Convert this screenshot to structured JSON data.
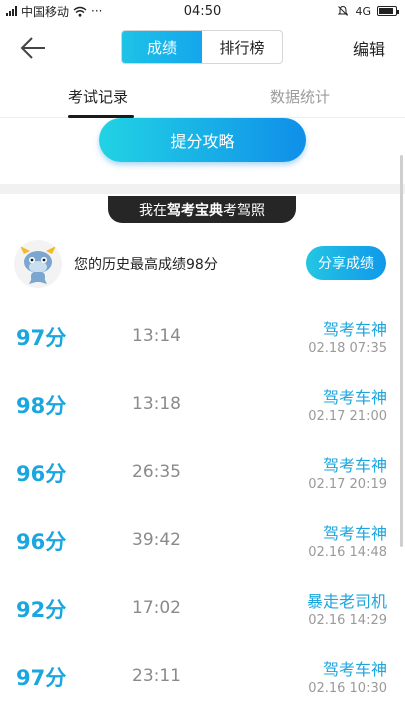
{
  "status_bar": {
    "carrier": "中国移动",
    "more": "···",
    "time": "04:50",
    "network": "4G"
  },
  "nav": {
    "segments": [
      "成绩",
      "排行榜"
    ],
    "active_segment": 0,
    "edit_label": "编辑"
  },
  "tabs": [
    {
      "label": "考试记录",
      "active": true
    },
    {
      "label": "数据统计",
      "active": false
    }
  ],
  "tip_button": "提分攻略",
  "banner": {
    "prefix": "我在",
    "brand": "驾考宝典",
    "suffix": "考驾照"
  },
  "best": {
    "text": "您的历史最高成绩98分",
    "share_label": "分享成绩"
  },
  "records": [
    {
      "score": "97分",
      "duration": "13:14",
      "title": "驾考车神",
      "date": "02.18  07:35"
    },
    {
      "score": "98分",
      "duration": "13:18",
      "title": "驾考车神",
      "date": "02.17  21:00"
    },
    {
      "score": "96分",
      "duration": "26:35",
      "title": "驾考车神",
      "date": "02.17  20:19"
    },
    {
      "score": "96分",
      "duration": "39:42",
      "title": "驾考车神",
      "date": "02.16  14:48"
    },
    {
      "score": "92分",
      "duration": "17:02",
      "title": "暴走老司机",
      "date": "02.16  14:29"
    },
    {
      "score": "97分",
      "duration": "23:11",
      "title": "驾考车神",
      "date": "02.16  10:30"
    }
  ],
  "colors": {
    "accent": "#1aa6df",
    "gradient_start": "#22d3e4",
    "gradient_end": "#0f8fe9"
  }
}
